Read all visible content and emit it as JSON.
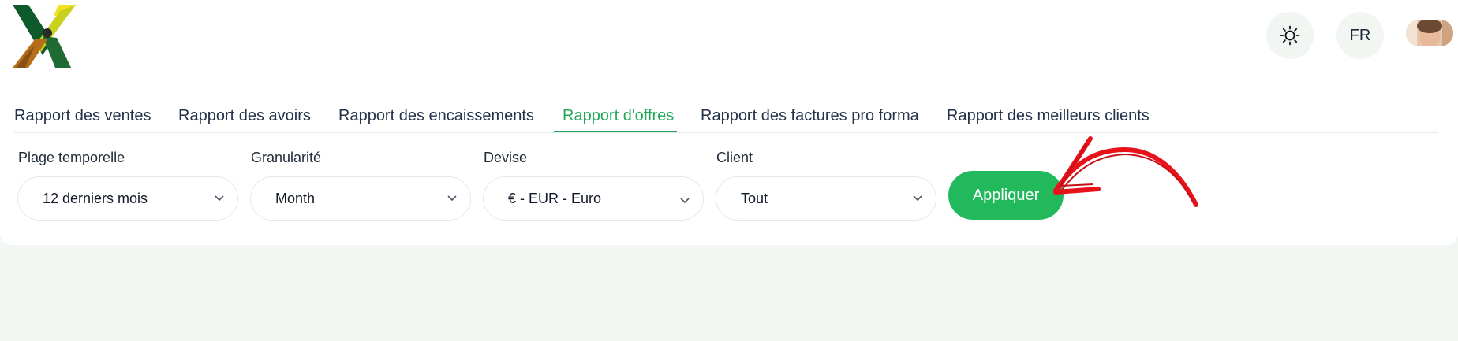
{
  "header": {
    "logo_icon": "app-logo",
    "theme_icon": "sun-icon",
    "language_label": "FR",
    "avatar_icon": "user-avatar"
  },
  "tabs": [
    {
      "label": "Rapport des ventes",
      "active": false
    },
    {
      "label": "Rapport des avoirs",
      "active": false
    },
    {
      "label": "Rapport des encaissements",
      "active": false
    },
    {
      "label": "Rapport d'offres",
      "active": true
    },
    {
      "label": "Rapport des factures pro forma",
      "active": false
    },
    {
      "label": "Rapport des meilleurs clients",
      "active": false
    }
  ],
  "filters": {
    "time_range": {
      "label": "Plage temporelle",
      "value": "12 derniers mois"
    },
    "granularity": {
      "label": "Granularité",
      "value": "Month"
    },
    "currency": {
      "label": "Devise",
      "value": "€ - EUR - Euro"
    },
    "client": {
      "label": "Client",
      "value": "Tout"
    }
  },
  "apply_label": "Appliquer",
  "annotation": {
    "icon": "red-arrow-icon",
    "color": "#e8121b"
  },
  "colors": {
    "accent": "#22b95d",
    "active_tab": "#22a85a",
    "page_bg": "#f3f7f4"
  }
}
